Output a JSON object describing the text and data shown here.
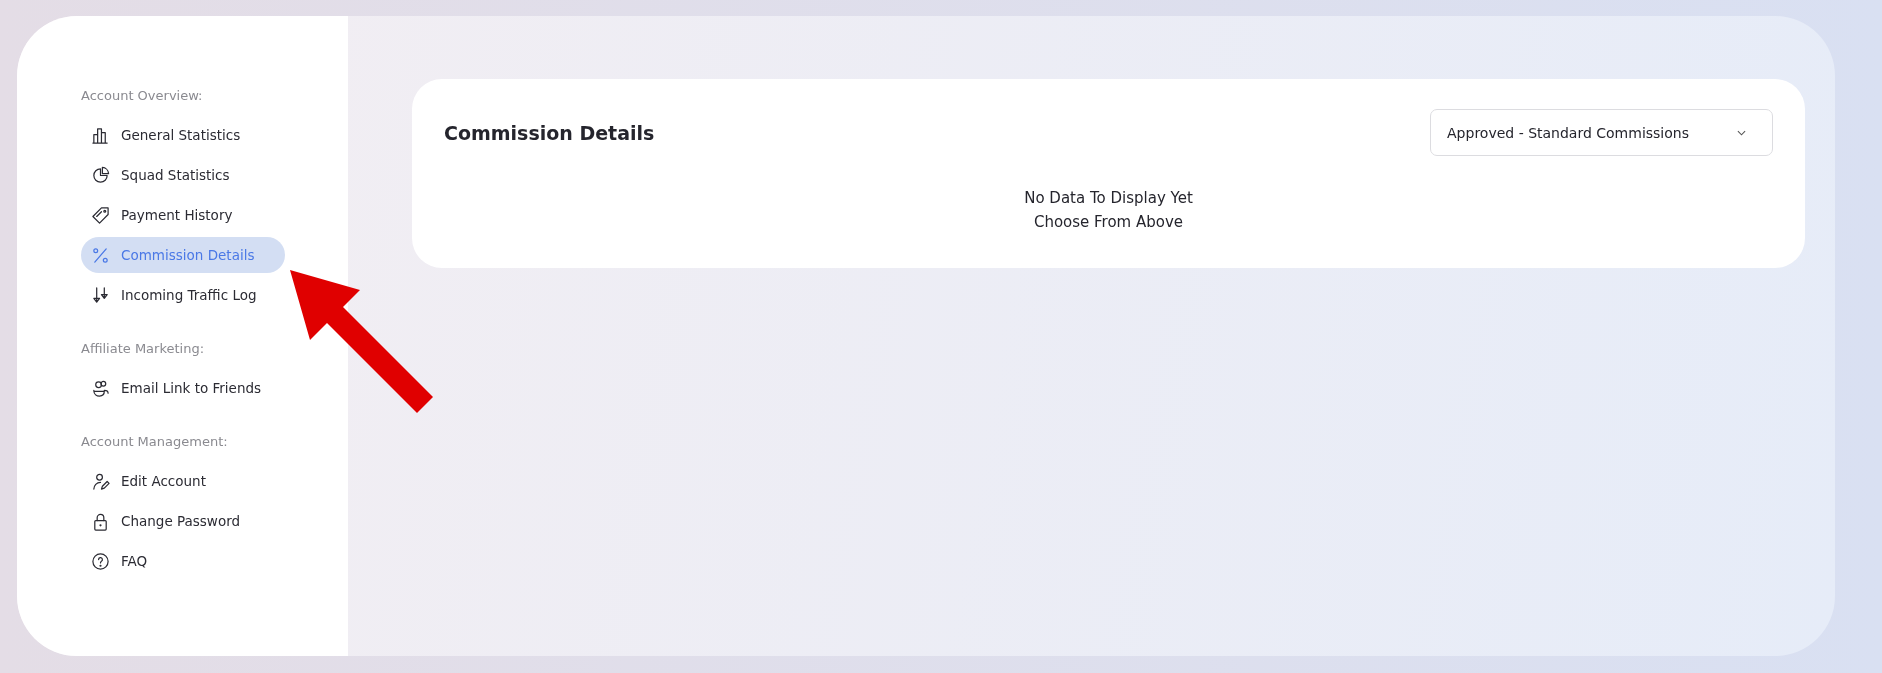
{
  "sidebar": {
    "sections": [
      {
        "label": "Account Overview:",
        "items": [
          {
            "label": "General Statistics",
            "selected": false
          },
          {
            "label": "Squad Statistics",
            "selected": false
          },
          {
            "label": "Payment History",
            "selected": false
          },
          {
            "label": "Commission Details",
            "selected": true
          },
          {
            "label": "Incoming Traffic Log",
            "selected": false
          }
        ]
      },
      {
        "label": "Affiliate Marketing:",
        "items": [
          {
            "label": "Email Link to Friends",
            "selected": false
          }
        ]
      },
      {
        "label": "Account Management:",
        "items": [
          {
            "label": "Edit Account",
            "selected": false
          },
          {
            "label": "Change Password",
            "selected": false
          },
          {
            "label": "FAQ",
            "selected": false
          }
        ]
      }
    ]
  },
  "card": {
    "title": "Commission Details",
    "dropdown": {
      "value": "Approved - Standard Commissions"
    },
    "empty_lines": [
      "No Data To Display Yet",
      "Choose From Above"
    ]
  }
}
